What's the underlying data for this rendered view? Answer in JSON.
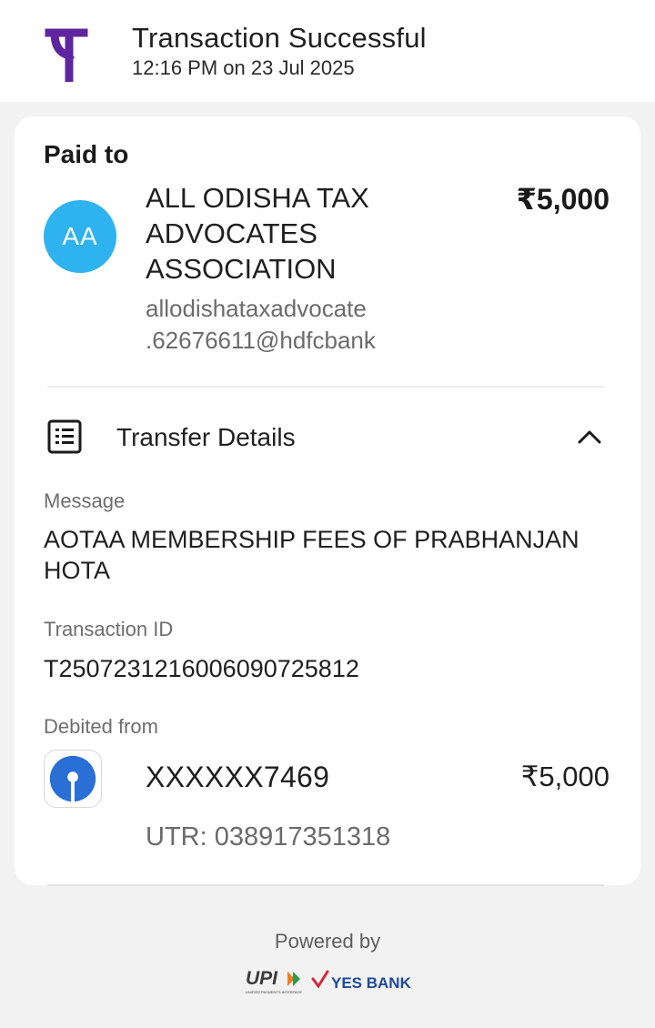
{
  "header": {
    "title": "Transaction Successful",
    "subtitle": "12:16 PM on 23 Jul 2025",
    "logo_icon": "phonepe-logo",
    "logo_color": "#5f259f"
  },
  "payee": {
    "section_label": "Paid to",
    "avatar_initials": "AA",
    "avatar_color": "#2fb2f0",
    "name": "ALL ODISHA TAX ADVOCATES ASSOCIATION",
    "upi_id_line1": "allodishataxadvocate",
    "upi_id_line2": ".62676611@hdfcbank",
    "amount": "₹5,000"
  },
  "transfer_details": {
    "title": "Transfer Details",
    "icon": "list-document-icon",
    "toggle_icon": "chevron-up-icon",
    "message_label": "Message",
    "message_line1": "AOTAA MEMBERSHIP FEES OF PRABHANJAN",
    "message_line2": "HOTA",
    "txn_id_label": "Transaction ID",
    "txn_id": "T2507231216006090725812",
    "debited_label": "Debited from",
    "bank_icon": "sbi-logo",
    "bank_color": "#2a6fd6",
    "account": "XXXXXX7469",
    "debit_amount": "₹5,000",
    "utr": "UTR: 038917351318"
  },
  "footer": {
    "powered_by": "Powered by",
    "upi_text": "UPI",
    "upi_tagline": "UNIFIED PAYMENTS INTERFACE",
    "bank_text": "YES BANK"
  }
}
